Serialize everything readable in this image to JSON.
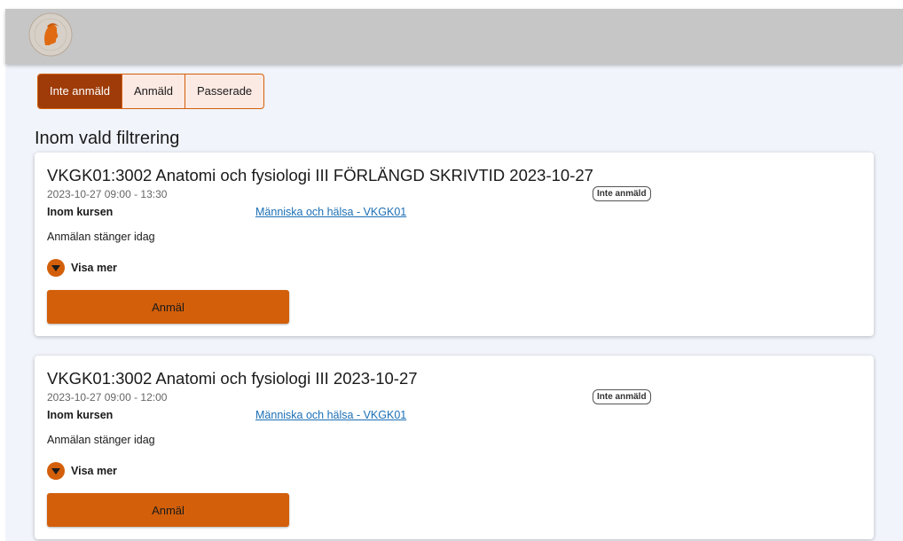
{
  "header": {
    "logo_icon": "university-seal-logo"
  },
  "tabs": [
    {
      "label": "Inte anmäld",
      "active": true
    },
    {
      "label": "Anmäld",
      "active": false
    },
    {
      "label": "Passerade",
      "active": false
    }
  ],
  "section_title": "Inom vald filtrering",
  "cards": [
    {
      "title": "VKGK01:3002 Anatomi och fysiologi III FÖRLÄNGD SKRIVTID 2023-10-27",
      "time": "2023-10-27 09:00 - 13:30",
      "status": "Inte anmäld",
      "course_label": "Inom kursen",
      "course_link": "Människa och hälsa - VKGK01",
      "closes": "Anmälan stänger idag",
      "show_more": "Visa mer",
      "action": "Anmäl"
    },
    {
      "title": "VKGK01:3002 Anatomi och fysiologi III 2023-10-27",
      "time": "2023-10-27 09:00 - 12:00",
      "status": "Inte anmäld",
      "course_label": "Inom kursen",
      "course_link": "Människa och hälsa - VKGK01",
      "closes": "Anmälan stänger idag",
      "show_more": "Visa mer",
      "action": "Anmäl"
    }
  ],
  "colors": {
    "accent": "#d35f0a",
    "tab_active": "#9e3b08",
    "tab_inactive_bg": "#fbe9e3",
    "header_bg": "#c6c6c6",
    "page_bg": "#f1f4fb",
    "link": "#1b6fb5"
  }
}
